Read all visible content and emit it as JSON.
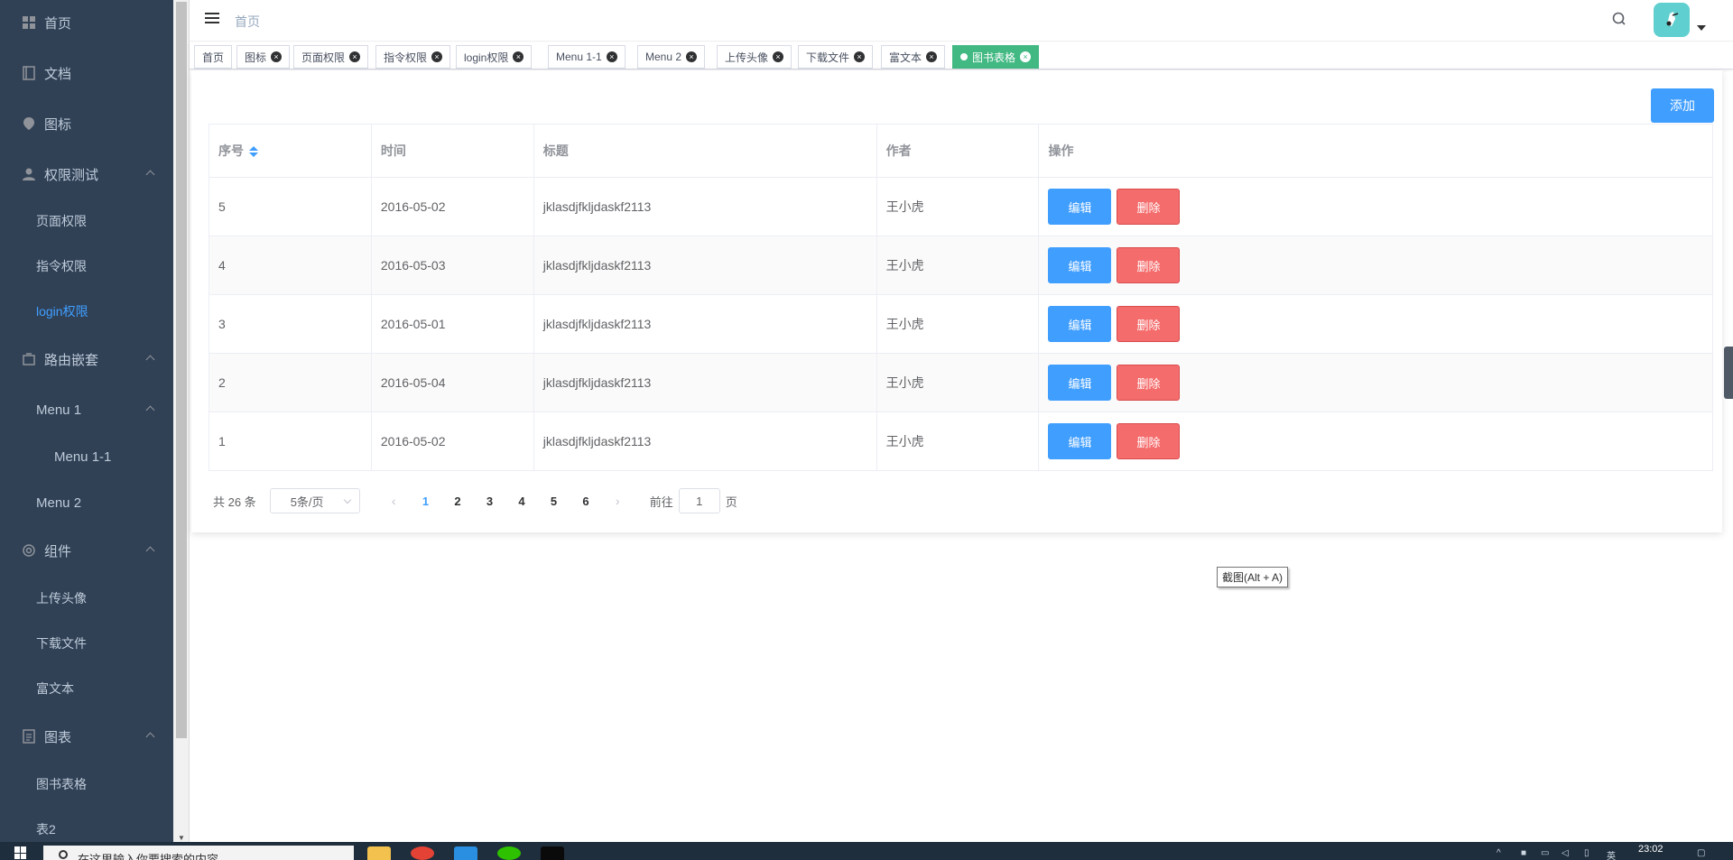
{
  "sidebar": {
    "items": [
      {
        "label": "首页",
        "icon": "dashboard-icon"
      },
      {
        "label": "文档",
        "icon": "document-icon"
      },
      {
        "label": "图标",
        "icon": "icon-icon"
      },
      {
        "label": "权限测试",
        "icon": "lock-icon"
      },
      {
        "label": "页面权限"
      },
      {
        "label": "指令权限"
      },
      {
        "label": "login权限"
      },
      {
        "label": "路由嵌套",
        "icon": "nested-icon"
      },
      {
        "label": "Menu 1"
      },
      {
        "label": "Menu 1-1"
      },
      {
        "label": "Menu 2"
      },
      {
        "label": "组件",
        "icon": "component-icon"
      },
      {
        "label": "上传头像"
      },
      {
        "label": "下载文件"
      },
      {
        "label": "富文本"
      },
      {
        "label": "图表",
        "icon": "chart-icon"
      },
      {
        "label": "图书表格"
      },
      {
        "label": "表2"
      }
    ],
    "active_color": "#409eff",
    "bg_color": "#304156"
  },
  "header": {
    "breadcrumb": "首页"
  },
  "tags": [
    {
      "label": "首页"
    },
    {
      "label": "图标"
    },
    {
      "label": "页面权限"
    },
    {
      "label": "指令权限"
    },
    {
      "label": "login权限"
    },
    {
      "label": "Menu 1-1"
    },
    {
      "label": "Menu 2"
    },
    {
      "label": "上传头像"
    },
    {
      "label": "下载文件"
    },
    {
      "label": "富文本"
    },
    {
      "label": "图书表格"
    }
  ],
  "toolbar": {
    "add_label": "添加"
  },
  "table": {
    "columns": [
      "序号",
      "时间",
      "标题",
      "作者",
      "操作"
    ],
    "rows": [
      {
        "id": "5",
        "date": "2016-05-02",
        "title": "jklasdjfkljdaskf2113",
        "author": "王小虎"
      },
      {
        "id": "4",
        "date": "2016-05-03",
        "title": "jklasdjfkljdaskf2113",
        "author": "王小虎"
      },
      {
        "id": "3",
        "date": "2016-05-01",
        "title": "jklasdjfkljdaskf2113",
        "author": "王小虎"
      },
      {
        "id": "2",
        "date": "2016-05-04",
        "title": "jklasdjfkljdaskf2113",
        "author": "王小虎"
      },
      {
        "id": "1",
        "date": "2016-05-02",
        "title": "jklasdjfkljdaskf2113",
        "author": "王小虎"
      }
    ],
    "edit_label": "编辑",
    "delete_label": "删除"
  },
  "pagination": {
    "total_text": "共 26 条",
    "page_size": "5条/页",
    "pages": [
      "1",
      "2",
      "3",
      "4",
      "5",
      "6"
    ],
    "current_page": "1",
    "prev_symbol": "‹",
    "next_symbol": "›",
    "goto_prefix": "前往",
    "goto_value": "1",
    "goto_suffix": "页"
  },
  "tooltip": "截图(Alt + A)",
  "taskbar": {
    "search_placeholder": "在这里输入你要搜索的内容",
    "time": "23:02"
  }
}
